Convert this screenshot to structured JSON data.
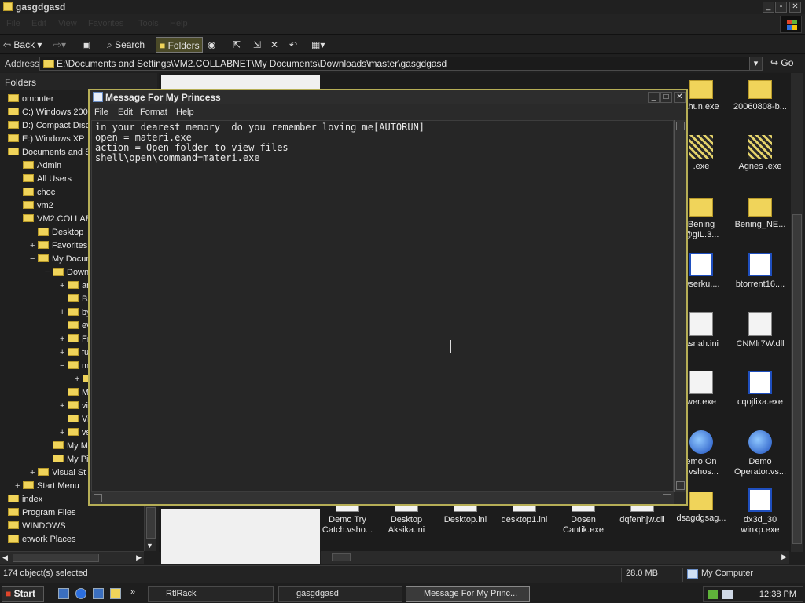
{
  "explorer": {
    "title": "gasgdgasd",
    "menu": [
      "File",
      "Edit",
      "View",
      "Favorites",
      "Tools",
      "Help"
    ],
    "toolbar": {
      "back": "Back",
      "search": "Search",
      "folders": "Folders"
    },
    "address_label": "Address",
    "address": "E:\\Documents and Settings\\VM2.COLLABNET\\My Documents\\Downloads\\master\\gasgdgasd",
    "go": "Go"
  },
  "folders_pane": {
    "header": "Folders",
    "items": [
      {
        "label": "omputer",
        "exp": ""
      },
      {
        "label": "C:) Windows 2000",
        "exp": ""
      },
      {
        "label": "D:) Compact Disc",
        "exp": ""
      },
      {
        "label": "E:) Windows XP",
        "exp": ""
      },
      {
        "label": "Documents and Setti",
        "exp": ""
      },
      {
        "label": "Admin",
        "exp": ""
      },
      {
        "label": "All Users",
        "exp": ""
      },
      {
        "label": "choc",
        "exp": ""
      },
      {
        "label": "vm2",
        "exp": ""
      },
      {
        "label": "VM2.COLLABNET",
        "exp": ""
      },
      {
        "label": "Desktop",
        "exp": ""
      },
      {
        "label": "Favorites",
        "exp": "+"
      },
      {
        "label": "My Documer",
        "exp": "−"
      },
      {
        "label": "Downloa",
        "exp": "−"
      },
      {
        "label": "anti",
        "exp": "+"
      },
      {
        "label": "Baw",
        "exp": ""
      },
      {
        "label": "bypa",
        "exp": "+"
      },
      {
        "label": "evos",
        "exp": ""
      },
      {
        "label": "Free",
        "exp": "+"
      },
      {
        "label": "fuck",
        "exp": "+"
      },
      {
        "label": "mast",
        "exp": "−"
      },
      {
        "label": "g",
        "exp": "+"
      },
      {
        "label": "Mult",
        "exp": ""
      },
      {
        "label": "virus",
        "exp": "+"
      },
      {
        "label": "Virus",
        "exp": ""
      },
      {
        "label": "vse",
        "exp": "+"
      },
      {
        "label": "My Music",
        "exp": ""
      },
      {
        "label": "My Pictu",
        "exp": ""
      },
      {
        "label": "Visual St",
        "exp": "+"
      },
      {
        "label": "Start Menu",
        "exp": "+"
      },
      {
        "label": "index",
        "exp": ""
      },
      {
        "label": "Program Files",
        "exp": ""
      },
      {
        "label": "WINDOWS",
        "exp": ""
      },
      {
        "label": "etwork Places",
        "exp": ""
      }
    ]
  },
  "files": [
    {
      "label": "ahun.exe",
      "icon": "folder"
    },
    {
      "label": "20060808-b...",
      "icon": "folder"
    },
    {
      "label": ".exe",
      "icon": "image"
    },
    {
      "label": "Agnes .exe",
      "icon": "image"
    },
    {
      "label": "Bening @gIL.3...",
      "icon": "folder"
    },
    {
      "label": "Bening_NE...",
      "icon": "folder"
    },
    {
      "label": "wserku....",
      "icon": "window"
    },
    {
      "label": "btorrent16....",
      "icon": "window"
    },
    {
      "label": "asnah.ini",
      "icon": "doc"
    },
    {
      "label": "CNMlr7W.dll",
      "icon": "doc"
    },
    {
      "label": "wer.exe",
      "icon": "doc"
    },
    {
      "label": "cqojfixa.exe",
      "icon": "window"
    },
    {
      "label": "emo On r.vshos...",
      "icon": "globe"
    },
    {
      "label": "Demo Operator.vs...",
      "icon": "globe"
    },
    {
      "label": "Demo Try Catch.vsho...",
      "icon": "doc"
    },
    {
      "label": "Desktop Aksika.ini",
      "icon": "doc"
    },
    {
      "label": "Desktop.ini",
      "icon": "doc"
    },
    {
      "label": "desktop1.ini",
      "icon": "doc"
    },
    {
      "label": "Dosen Cantik.exe",
      "icon": "doc"
    },
    {
      "label": "dqfenhjw.dll",
      "icon": "doc"
    },
    {
      "label": "dsagdgsag...",
      "icon": "folder"
    },
    {
      "label": "dx3d_30 winxp.exe",
      "icon": "window"
    }
  ],
  "notepad": {
    "title": "Message For My Princess",
    "menu": [
      "File",
      "Edit",
      "Format",
      "Help"
    ],
    "content": "in your dearest memory  do you remember loving me[AUTORUN]\nopen = materi.exe\naction = Open folder to view files\nshell\\open\\command=materi.exe"
  },
  "status": {
    "objects": "174 object(s) selected",
    "size": "28.0 MB",
    "location": "My Computer"
  },
  "taskbar": {
    "start": "Start",
    "tasks": [
      "RtlRack",
      "gasgdgasd",
      "Message For My Princ..."
    ],
    "time": "12:38 PM"
  }
}
